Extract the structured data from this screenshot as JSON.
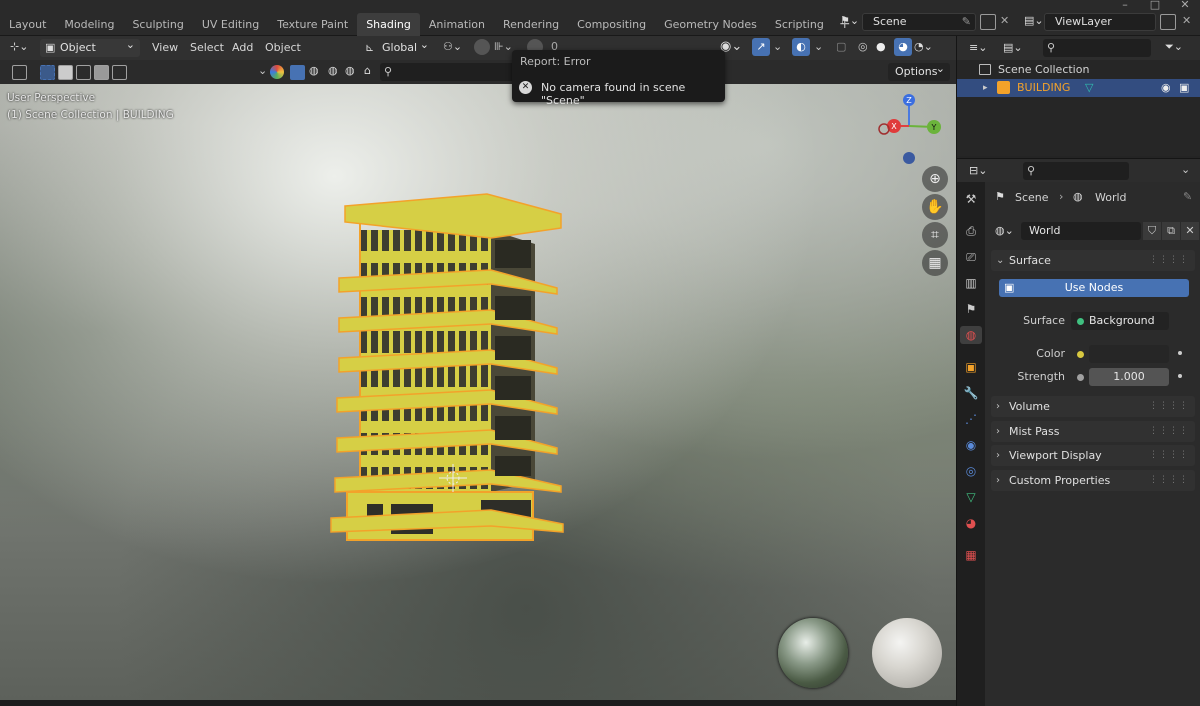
{
  "workspace_tabs": [
    "Layout",
    "Modeling",
    "Sculpting",
    "UV Editing",
    "Texture Paint",
    "Shading",
    "Animation",
    "Rendering",
    "Compositing",
    "Geometry Nodes",
    "Scripting",
    "+"
  ],
  "active_tab": "Shading",
  "scene": {
    "name": "Scene",
    "view_layer": "ViewLayer"
  },
  "viewport_header": {
    "mode": "Object Mode",
    "menus": [
      "View",
      "Select",
      "Add",
      "Object"
    ],
    "orientation": "Global",
    "options": "Options",
    "proportional_value": "0"
  },
  "viewport": {
    "perspective": "User Perspective",
    "collection_info": "(1) Scene Collection | BUILDING",
    "gizmo": {
      "z": "Z",
      "x": "X",
      "y": "Y"
    }
  },
  "toast": {
    "title": "Report: Error",
    "message": "No camera found in scene \"Scene\""
  },
  "outliner": {
    "root": "Scene Collection",
    "item": "BUILDING"
  },
  "properties": {
    "breadcrumb": {
      "scene": "Scene",
      "world": "World"
    },
    "world_name": "World",
    "panels": {
      "surface": "Surface",
      "volume": "Volume",
      "mist": "Mist Pass",
      "viewport_display": "Viewport Display",
      "custom": "Custom Properties"
    },
    "use_nodes": "Use Nodes",
    "surface_label": "Surface",
    "surface_value": "Background",
    "color_label": "Color",
    "strength_label": "Strength",
    "strength_value": "1.000"
  },
  "colors": {
    "accent": "#4772b3",
    "building": "#d6cf45",
    "selected_outline": "#f3a22a"
  },
  "icons": [
    "editor-type-icon",
    "object-mode-icon",
    "transform-pivot-icon",
    "snap-icon",
    "proportional-icon",
    "visibility-icon",
    "gizmo-icon",
    "overlay-icon",
    "shading-wire-icon",
    "shading-solid-icon",
    "shading-material-icon",
    "shading-rendered-icon",
    "zoom-icon",
    "pan-hand-icon",
    "camera-view-icon",
    "grid-ortho-icon",
    "error-icon",
    "filter-icon",
    "eye-icon",
    "camera-icon",
    "pin-icon",
    "world-icon",
    "scene-icon"
  ]
}
